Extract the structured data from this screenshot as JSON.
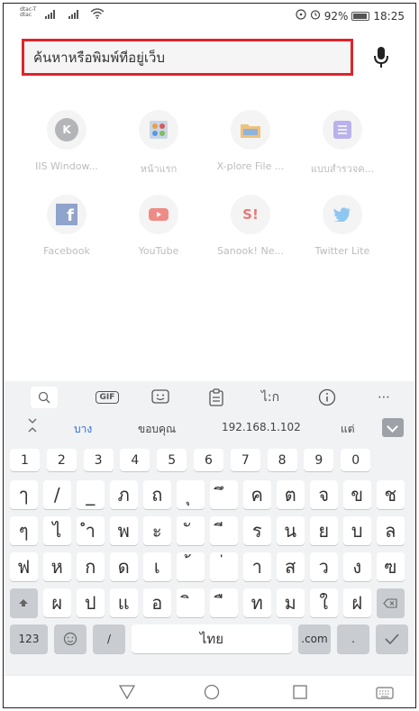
{
  "status": {
    "carrier_line1": "dtac-T",
    "carrier_line2": "dtac",
    "signal1": "4G",
    "battery": "92%",
    "time": "18:25"
  },
  "search": {
    "placeholder": "ค้นหาหรือพิมพ์ที่อยู่เว็บ"
  },
  "shortcuts": [
    {
      "label": "IIS Window...",
      "icon": "K",
      "color": "#a6a8ab"
    },
    {
      "label": "หน้าแรก",
      "icon": "joomla-icon",
      "color": "#7fa3d0"
    },
    {
      "label": "X-plore File ...",
      "icon": "folder-icon",
      "color": "#e3a64d"
    },
    {
      "label": "แบบสำรวจค...",
      "icon": "form-icon",
      "color": "#8a7fd6"
    },
    {
      "label": "Facebook",
      "icon": "f",
      "color": "#3b5998"
    },
    {
      "label": "YouTube",
      "icon": "play-icon",
      "color": "#e8453c"
    },
    {
      "label": "Sanook! Ne...",
      "icon": "S!",
      "color": "#e02d2d"
    },
    {
      "label": "Twitter Lite",
      "icon": "bird-icon",
      "color": "#47a9ea"
    }
  ],
  "keyboard": {
    "toolbar": [
      "GIF",
      "ไ:ก"
    ],
    "suggestions": [
      "บาง",
      "ขอบคุณ",
      "192.168.1.102",
      "แต่"
    ],
    "numbers": [
      "1",
      "2",
      "3",
      "4",
      "5",
      "6",
      "7",
      "8",
      "9",
      "0"
    ],
    "row1": [
      "ๅ",
      "/",
      "_",
      "ภ",
      "ถ",
      "ุ",
      "ึ",
      "ค",
      "ต",
      "จ",
      "ข",
      "ช"
    ],
    "row2": [
      "ๆ",
      "ไ",
      "ำ",
      "พ",
      "ะ",
      "ั",
      "ี",
      "ร",
      "น",
      "ย",
      "บ",
      "ล"
    ],
    "row3": [
      "ฟ",
      "ห",
      "ก",
      "ด",
      "เ",
      "้",
      "่",
      "า",
      "ส",
      "ว",
      "ง",
      "ฃ"
    ],
    "row4": [
      "ผ",
      "ป",
      "แ",
      "อ",
      "ิ",
      "ื",
      "ท",
      "ม",
      "ใ",
      "ฝ"
    ],
    "bottom": {
      "num_mode": "123",
      "slash": "/",
      "space": "ไทย",
      "com": ".com",
      "dot": "."
    }
  }
}
